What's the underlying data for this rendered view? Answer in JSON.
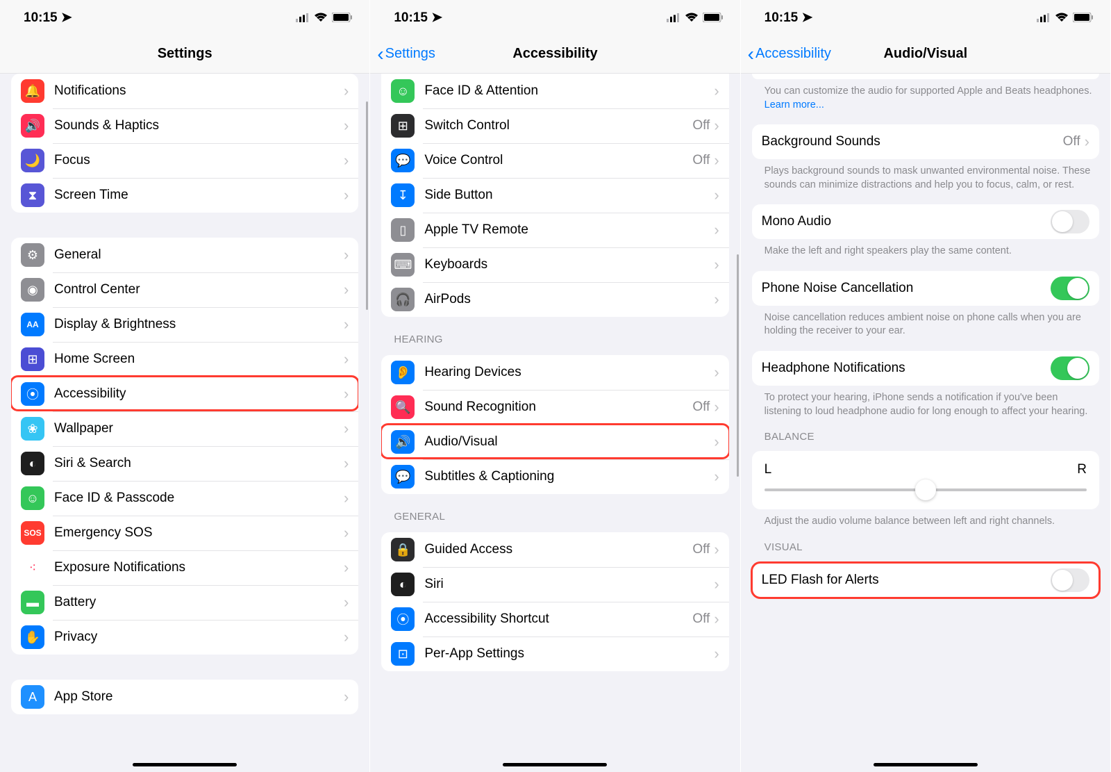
{
  "status": {
    "time": "10:15",
    "location_glyph": "➤",
    "cell": "⬪⬪⬪",
    "wifi": "📶",
    "batt": "䷀"
  },
  "screen1": {
    "title": "Settings",
    "groupA": [
      {
        "icon": "🔔",
        "bg": "#ff3b30",
        "name": "notifications",
        "label": "Notifications"
      },
      {
        "icon": "🔊",
        "bg": "#ff2d55",
        "name": "sounds-haptics",
        "label": "Sounds & Haptics"
      },
      {
        "icon": "🌙",
        "bg": "#5856d6",
        "name": "focus",
        "label": "Focus"
      },
      {
        "icon": "⧗",
        "bg": "#5856d6",
        "name": "screen-time",
        "label": "Screen Time"
      }
    ],
    "groupB": [
      {
        "icon": "⚙",
        "bg": "#8e8e93",
        "name": "general",
        "label": "General"
      },
      {
        "icon": "◉",
        "bg": "#8e8e93",
        "name": "control-center",
        "label": "Control Center"
      },
      {
        "icon": "AA",
        "bg": "#007aff",
        "name": "display-brightness",
        "label": "Display & Brightness",
        "small": true
      },
      {
        "icon": "⊞",
        "bg": "#4b4dd4",
        "name": "home-screen",
        "label": "Home Screen"
      },
      {
        "icon": "⦿",
        "bg": "#007aff",
        "name": "accessibility",
        "label": "Accessibility",
        "hl": true
      },
      {
        "icon": "❀",
        "bg": "#35c5f4",
        "name": "wallpaper",
        "label": "Wallpaper"
      },
      {
        "icon": "◐",
        "bg": "#1e1e1e",
        "name": "siri-search",
        "label": "Siri & Search"
      },
      {
        "icon": "☺",
        "bg": "#34c759",
        "name": "face-id-passcode",
        "label": "Face ID & Passcode"
      },
      {
        "icon": "SOS",
        "bg": "#ff3b30",
        "name": "emergency-sos",
        "label": "Emergency SOS",
        "small": true
      },
      {
        "icon": "⁖",
        "bg": "#ff2d55",
        "name": "exposure-notifications",
        "label": "Exposure Notifications",
        "whitebg": true
      },
      {
        "icon": "▬",
        "bg": "#34c759",
        "name": "battery",
        "label": "Battery"
      },
      {
        "icon": "✋",
        "bg": "#007aff",
        "name": "privacy",
        "label": "Privacy"
      }
    ],
    "groupC": [
      {
        "icon": "A",
        "bg": "#1e90ff",
        "name": "app-store",
        "label": "App Store"
      }
    ]
  },
  "screen2": {
    "back": "Settings",
    "title": "Accessibility",
    "groupA": [
      {
        "icon": "☺",
        "bg": "#34c759",
        "name": "face-id-attention",
        "label": "Face ID & Attention"
      },
      {
        "icon": "⊞",
        "bg": "#2c2c2e",
        "name": "switch-control",
        "label": "Switch Control",
        "value": "Off"
      },
      {
        "icon": "💬",
        "bg": "#007aff",
        "name": "voice-control",
        "label": "Voice Control",
        "value": "Off"
      },
      {
        "icon": "↧",
        "bg": "#007aff",
        "name": "side-button",
        "label": "Side Button"
      },
      {
        "icon": "▯",
        "bg": "#8e8e93",
        "name": "apple-tv-remote",
        "label": "Apple TV Remote"
      },
      {
        "icon": "⌨",
        "bg": "#8e8e93",
        "name": "keyboards",
        "label": "Keyboards"
      },
      {
        "icon": "🎧",
        "bg": "#8e8e93",
        "name": "airpods",
        "label": "AirPods"
      }
    ],
    "hearingHeader": "HEARING",
    "groupB": [
      {
        "icon": "👂",
        "bg": "#007aff",
        "name": "hearing-devices",
        "label": "Hearing Devices"
      },
      {
        "icon": "🔍",
        "bg": "#ff2d55",
        "name": "sound-recognition",
        "label": "Sound Recognition",
        "value": "Off"
      },
      {
        "icon": "🔊",
        "bg": "#007aff",
        "name": "audio-visual",
        "label": "Audio/Visual",
        "hl": true
      },
      {
        "icon": "💬",
        "bg": "#007aff",
        "name": "subtitles-captioning",
        "label": "Subtitles & Captioning"
      }
    ],
    "generalHeader": "GENERAL",
    "groupC": [
      {
        "icon": "🔒",
        "bg": "#2c2c2e",
        "name": "guided-access",
        "label": "Guided Access",
        "value": "Off"
      },
      {
        "icon": "◐",
        "bg": "#1e1e1e",
        "name": "siri",
        "label": "Siri"
      },
      {
        "icon": "⦿",
        "bg": "#007aff",
        "name": "accessibility-shortcut",
        "label": "Accessibility Shortcut",
        "value": "Off"
      },
      {
        "icon": "⊡",
        "bg": "#007aff",
        "name": "per-app-settings",
        "label": "Per-App Settings"
      }
    ]
  },
  "screen3": {
    "back": "Accessibility",
    "title": "Audio/Visual",
    "headphoneDesc": "You can customize the audio for supported Apple and Beats headphones.",
    "learnMore": "Learn more...",
    "bgSounds": {
      "label": "Background Sounds",
      "value": "Off"
    },
    "bgDesc": "Plays background sounds to mask unwanted environmental noise. These sounds can minimize distractions and help you to focus, calm, or rest.",
    "mono": {
      "label": "Mono Audio",
      "on": false
    },
    "monoDesc": "Make the left and right speakers play the same content.",
    "noise": {
      "label": "Phone Noise Cancellation",
      "on": true
    },
    "noiseDesc": "Noise cancellation reduces ambient noise on phone calls when you are holding the receiver to your ear.",
    "headNotif": {
      "label": "Headphone Notifications",
      "on": true
    },
    "headNotifDesc": "To protect your hearing, iPhone sends a notification if you've been listening to loud headphone audio for long enough to affect your hearing.",
    "balanceHeader": "BALANCE",
    "balanceL": "L",
    "balanceR": "R",
    "balanceDesc": "Adjust the audio volume balance between left and right channels.",
    "visualHeader": "VISUAL",
    "led": {
      "label": "LED Flash for Alerts",
      "on": false
    }
  }
}
